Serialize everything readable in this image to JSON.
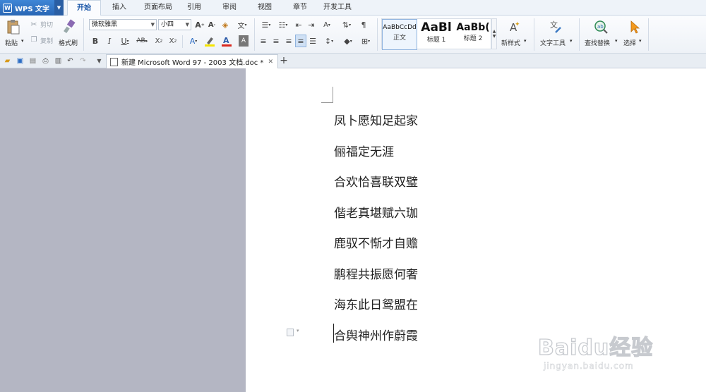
{
  "app": {
    "name": "WPS 文字",
    "logo": "W"
  },
  "menu_tabs": [
    "开始",
    "插入",
    "页面布局",
    "引用",
    "审阅",
    "视图",
    "章节",
    "开发工具"
  ],
  "active_tab": "开始",
  "ribbon": {
    "paste_label": "粘贴",
    "cut_label": "剪切",
    "copy_label": "复制",
    "format_painter_label": "格式刷",
    "font_name": "微软雅黑",
    "font_size": "小四",
    "styles": [
      {
        "preview": "AaBbCcDd",
        "name": "正文"
      },
      {
        "preview": "AaBl",
        "name": "标题 1"
      },
      {
        "preview": "AaBb(",
        "name": "标题 2"
      }
    ],
    "new_style_label": "新样式",
    "text_tools_label": "文字工具",
    "find_replace_label": "查找替换",
    "select_label": "选择",
    "colors": {
      "highlight": "#f5e400",
      "font_color": "#d9281e",
      "accent": "#2b6cc4"
    }
  },
  "document_tab": {
    "title": "新建 Microsoft Word 97 - 2003 文档.doc *"
  },
  "document": {
    "lines": [
      "凤卜愿知足起家",
      "俪福定无涯",
      "合欢恰喜联双璧",
      "偕老真堪赋六珈",
      "鹿驭不惭才自赡",
      "鹏程共振愿何奢",
      "海东此日鸳盟在",
      "合舆神州作蔚霞"
    ]
  },
  "watermark": {
    "brand": "Baidu经验",
    "url": "jingyan.baidu.com"
  }
}
